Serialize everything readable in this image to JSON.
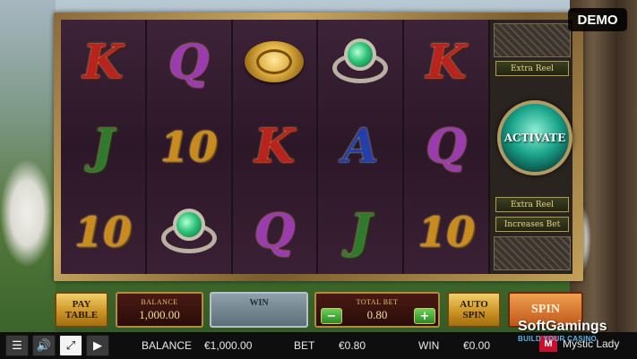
{
  "badge": {
    "demo": "DEMO"
  },
  "reels": [
    [
      {
        "type": "letter",
        "glyph": "K",
        "cls": "K"
      },
      {
        "type": "letter",
        "glyph": "J",
        "cls": "J"
      },
      {
        "type": "letter",
        "glyph": "10",
        "cls": "T"
      }
    ],
    [
      {
        "type": "letter",
        "glyph": "Q",
        "cls": "Q"
      },
      {
        "type": "letter",
        "glyph": "10",
        "cls": "T"
      },
      {
        "type": "ring"
      }
    ],
    [
      {
        "type": "coin"
      },
      {
        "type": "letter",
        "glyph": "K",
        "cls": "K"
      },
      {
        "type": "letter",
        "glyph": "Q",
        "cls": "Q"
      }
    ],
    [
      {
        "type": "ring"
      },
      {
        "type": "letter",
        "glyph": "A",
        "cls": "A"
      },
      {
        "type": "letter",
        "glyph": "J",
        "cls": "J"
      }
    ],
    [
      {
        "type": "letter",
        "glyph": "K",
        "cls": "K"
      },
      {
        "type": "letter",
        "glyph": "Q",
        "cls": "Q"
      },
      {
        "type": "letter",
        "glyph": "10",
        "cls": "T"
      }
    ]
  ],
  "side": {
    "extra_reel_top": "Extra Reel",
    "activate": "ACTIVATE",
    "extra_reel_bottom": "Extra Reel",
    "increases_bet": "Increases Bet"
  },
  "controls": {
    "pay_table": "PAY TABLE",
    "balance_label": "BALANCE",
    "balance_value": "1,000.00",
    "win_label": "WIN",
    "total_bet_label": "TOTAL BET",
    "total_bet_value": "0.80",
    "minus": "−",
    "plus": "+",
    "auto_spin": "AUTO SPIN",
    "spin": "SPIN"
  },
  "status_bar": {
    "balance_label": "BALANCE",
    "balance_value": "€1,000.00",
    "bet_label": "BET",
    "bet_value": "€0.80",
    "win_label": "WIN",
    "win_value": "€0.00",
    "game_name": "Mystic Lady",
    "game_logo": "M"
  },
  "watermark": {
    "brand": "SoftGamings",
    "tagline": "BUILD YOUR CASINO"
  }
}
